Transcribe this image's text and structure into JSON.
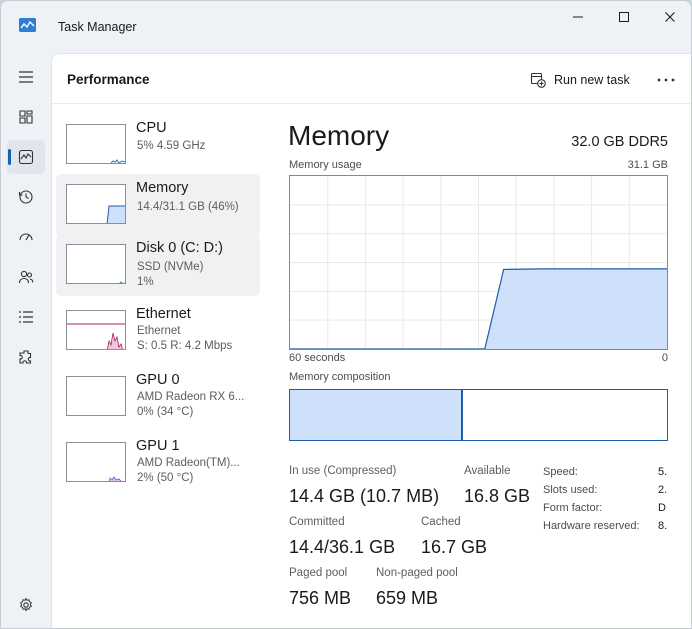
{
  "window": {
    "title": "Task Manager",
    "accent_color": "#1b5fb3"
  },
  "nav": {
    "items": [
      {
        "icon": "hamburger-menu-icon"
      },
      {
        "icon": "processes-icon"
      },
      {
        "icon": "performance-icon",
        "active": true
      },
      {
        "icon": "app-history-icon"
      },
      {
        "icon": "startup-apps-icon"
      },
      {
        "icon": "users-icon"
      },
      {
        "icon": "details-icon"
      },
      {
        "icon": "services-icon"
      }
    ],
    "settings_icon": "settings-gear-icon"
  },
  "header": {
    "title": "Performance",
    "run_new_task": "Run new task"
  },
  "devices": [
    {
      "name": "CPU",
      "line1": "5%  4.59 GHz",
      "line2": "",
      "color": "#2b7bbf"
    },
    {
      "name": "Memory",
      "line1": "14.4/31.1 GB (46%)",
      "line2": "",
      "color": "#1f5da8",
      "usage_fraction": 0.46,
      "selected": true
    },
    {
      "name": "Disk 0 (C: D:)",
      "line1": "SSD (NVMe)",
      "line2": "1%",
      "color": "#4a9a2e"
    },
    {
      "name": "Ethernet",
      "line1": "Ethernet",
      "line2": "S: 0.5  R: 4.2 Mbps",
      "color": "#a5216b"
    },
    {
      "name": "GPU 0",
      "line1": "AMD Radeon RX 6...",
      "line2": "0%  (34 °C)",
      "color": "#8a3fbf"
    },
    {
      "name": "GPU 1",
      "line1": "AMD Radeon(TM)...",
      "line2": "2%  (50 °C)",
      "color": "#8a3fbf"
    }
  ],
  "detail": {
    "title": "Memory",
    "spec": "32.0 GB DDR5",
    "usage_label": "Memory usage",
    "usage_max": "31.1 GB",
    "x_left": "60 seconds",
    "x_right": "0",
    "composition_label": "Memory composition",
    "composition_in_use_fraction": 0.46,
    "stats": {
      "in_use_label": "In use (Compressed)",
      "in_use_value": "14.4 GB (10.7 MB)",
      "available_label": "Available",
      "available_value": "16.8 GB",
      "committed_label": "Committed",
      "committed_value": "14.4/36.1 GB",
      "cached_label": "Cached",
      "cached_value": "16.7 GB",
      "paged_label": "Paged pool",
      "paged_value": "756 MB",
      "nonpaged_label": "Non-paged pool",
      "nonpaged_value": "659 MB"
    },
    "specs": [
      {
        "label": "Speed:",
        "value": "5."
      },
      {
        "label": "Slots used:",
        "value": "2."
      },
      {
        "label": "Form factor:",
        "value": "D"
      },
      {
        "label": "Hardware reserved:",
        "value": "8."
      }
    ]
  },
  "chart_data": {
    "type": "area",
    "title": "Memory usage",
    "xlabel": "",
    "ylabel": "",
    "x_label_left": "60 seconds",
    "x_label_right": "0",
    "ylim": [
      0,
      31.1
    ],
    "grid": true,
    "series": [
      {
        "x": [
          60,
          29,
          26,
          20,
          10,
          0
        ],
        "values": [
          0,
          0,
          14.3,
          14.4,
          14.4,
          14.4
        ]
      }
    ],
    "fill_color": "#cfe0fb",
    "line_color": "#1f5da8"
  }
}
